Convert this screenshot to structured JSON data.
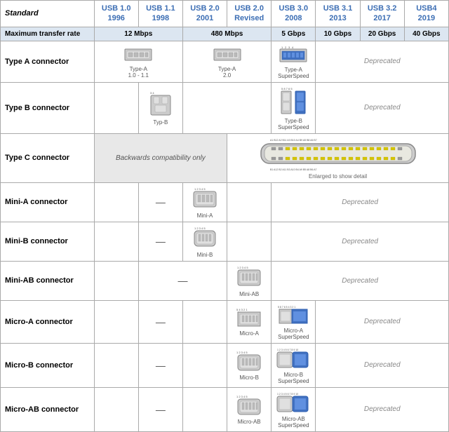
{
  "table": {
    "header": {
      "standard_label": "Standard",
      "columns": [
        {
          "id": "usb10",
          "name": "USB 1.0",
          "year": "1996",
          "color": "#3c6eb4"
        },
        {
          "id": "usb11",
          "name": "USB 1.1",
          "year": "1998",
          "color": "#3c6eb4"
        },
        {
          "id": "usb20",
          "name": "USB 2.0",
          "year": "2001",
          "color": "#3c6eb4"
        },
        {
          "id": "usb20r",
          "name": "USB 2.0 Revised",
          "year": "",
          "color": "#3c6eb4"
        },
        {
          "id": "usb30",
          "name": "USB 3.0",
          "year": "2008",
          "color": "#3c6eb4"
        },
        {
          "id": "usb31",
          "name": "USB 3.1",
          "year": "2013",
          "color": "#3c6eb4"
        },
        {
          "id": "usb32",
          "name": "USB 3.2",
          "year": "2017",
          "color": "#3c6eb4"
        },
        {
          "id": "usb4",
          "name": "USB4",
          "year": "2019",
          "color": "#3c6eb4"
        }
      ]
    },
    "transfer_row": {
      "label": "Maximum transfer rate",
      "values": [
        "12 Mbps",
        "480 Mbps",
        "5 Gbps",
        "10 Gbps",
        "20 Gbps",
        "40 Gbps"
      ]
    },
    "rows": [
      {
        "id": "typeA",
        "label": "Type A connector",
        "cells": {
          "usb10_11": "Type-A 1.0 - 1.1",
          "usb20_20r": "Type-A 2.0",
          "usb30": "Type-A SuperSpeed",
          "deprecated": "Deprecated"
        }
      },
      {
        "id": "typeB",
        "label": "Type B connector",
        "cells": {
          "usb11": "",
          "usb30": "Type-B SuperSpeed",
          "deprecated": "Deprecated"
        }
      },
      {
        "id": "typeC",
        "label": "Type C connector",
        "backwards": "Backwards compatibility only",
        "typeC_note": "Enlarged to show detail",
        "deprecated_label": ""
      },
      {
        "id": "miniA",
        "label": "Mini-A connector",
        "dash": "—",
        "usb20": "Mini-A",
        "deprecated": "Deprecated"
      },
      {
        "id": "miniB",
        "label": "Mini-B connector",
        "dash": "—",
        "usb20": "Mini-B",
        "deprecated": "Deprecated"
      },
      {
        "id": "miniAB",
        "label": "Mini-AB connector",
        "dash": "—",
        "usb20r": "Mini-AB",
        "deprecated": "Deprecated"
      },
      {
        "id": "microA",
        "label": "Micro-A connector",
        "dash": "—",
        "usb20r": "Micro-A",
        "usb30": "Micro-A SuperSpeed",
        "deprecated": "Deprecated"
      },
      {
        "id": "microB",
        "label": "Micro-B connector",
        "dash": "—",
        "usb20r": "Micro-B",
        "usb30": "Micro-B SuperSpeed",
        "deprecated": "Deprecated"
      },
      {
        "id": "microAB",
        "label": "Micro-AB connector",
        "dash": "—",
        "usb20r": "Micro-AB",
        "usb30": "Micro-AB SuperSpeed",
        "deprecated": "Deprecated"
      }
    ]
  }
}
